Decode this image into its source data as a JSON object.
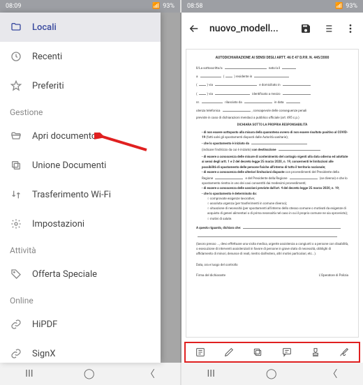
{
  "left": {
    "status": {
      "time": "08:09",
      "battery": "93%"
    },
    "drawer": {
      "items": [
        {
          "label": "Locali",
          "icon": "folder-icon",
          "active": true
        },
        {
          "label": "Recenti",
          "icon": "clock-icon"
        },
        {
          "label": "Preferiti",
          "icon": "star-icon"
        }
      ],
      "section_gestione": "Gestione",
      "gestione_items": [
        {
          "label": "Apri documento",
          "icon": "folder-open-icon"
        },
        {
          "label": "Unione Documenti",
          "icon": "copy-icon"
        },
        {
          "label": "Trasferimento Wi-Fi",
          "icon": "transfer-icon"
        },
        {
          "label": "Impostazioni",
          "icon": "gear-icon"
        }
      ],
      "section_attivita": "Attività",
      "attivita_items": [
        {
          "label": "Offerta Speciale",
          "icon": "tag-icon"
        }
      ],
      "section_online": "Online",
      "online_items": [
        {
          "label": "HiPDF",
          "icon": "link-icon"
        },
        {
          "label": "SignX",
          "icon": "link-icon"
        }
      ]
    }
  },
  "right": {
    "status": {
      "time": "08:58",
      "battery": "93%"
    },
    "header": {
      "title": "nuovo_modell..."
    },
    "toolbar_icons": [
      "list-icon",
      "pen-icon",
      "copy-icon",
      "comment-icon",
      "stamp-icon",
      "sign-icon"
    ],
    "document": {
      "title_line": "AUTODICHIARAZIONE AI SENSI DEGLI ARTT. 46 E 47 D.P.R. N. 445/2000",
      "subtitle": "DICHIARA SOTTO LA PROPRIA RESPONSABILITÀ"
    }
  }
}
